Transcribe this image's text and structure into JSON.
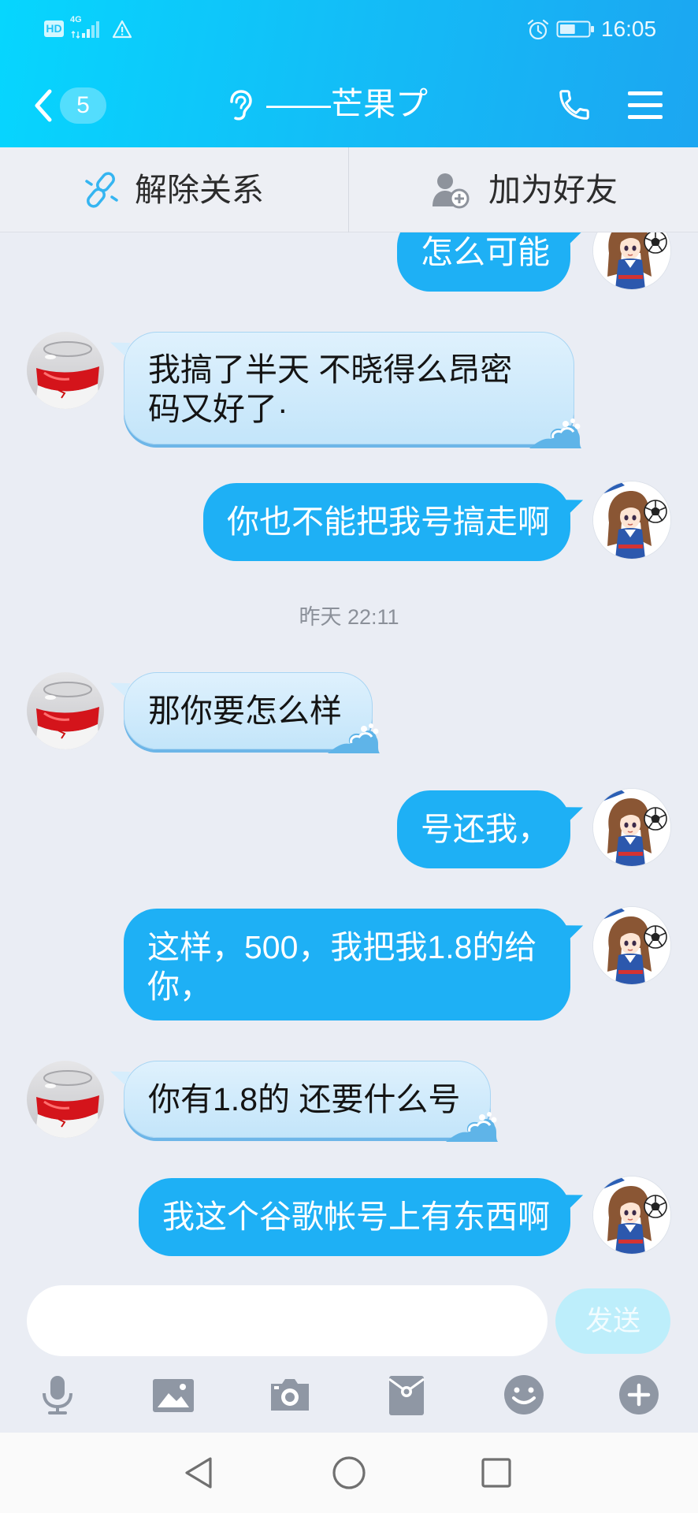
{
  "status_bar": {
    "hd_label": "HD",
    "network_label": "4G",
    "time": "16:05",
    "battery_level": 0.55,
    "icons": [
      "hd-icon",
      "signal-icon",
      "warning-icon",
      "alarm-icon",
      "battery-icon"
    ]
  },
  "header": {
    "unread_count": "5",
    "title": "——芒果プ",
    "icons": [
      "back-chevron-icon",
      "ear-icon",
      "phone-icon",
      "menu-icon"
    ]
  },
  "action_bar": {
    "unbind": {
      "label": "解除关系",
      "icon": "broken-link-icon"
    },
    "add_friend": {
      "label": "加为好友",
      "icon": "add-friend-icon"
    }
  },
  "chat": [
    {
      "outgoing": true,
      "text": "怎么可能"
    },
    {
      "outgoing": false,
      "text": "我搞了半天 不晓得么昂密码又好了·"
    },
    {
      "outgoing": true,
      "text": "你也不能把我号搞走啊"
    },
    {
      "timestamp": "昨天 22:11"
    },
    {
      "outgoing": false,
      "text": "那你要怎么样"
    },
    {
      "outgoing": true,
      "text": "号还我，"
    },
    {
      "outgoing": true,
      "text": "这样，500，我把我1.8的给你，"
    },
    {
      "outgoing": false,
      "text": "你有1.8的 还要什么号"
    },
    {
      "outgoing": true,
      "text": "我这个谷歌帐号上有东西啊"
    }
  ],
  "composer": {
    "input_value": "",
    "send_label": "发送"
  },
  "toolbar": [
    "microphone-icon",
    "image-icon",
    "camera-icon",
    "red-packet-icon",
    "emoji-icon",
    "plus-icon"
  ],
  "nav_bar": [
    "back-triangle-icon",
    "home-circle-icon",
    "recents-square-icon"
  ],
  "colors": {
    "header_gradient_start": "#06d6fe",
    "header_gradient_end": "#1ca6f1",
    "outgoing_bubble": "#1eb0f5",
    "incoming_bubble": "#c3e5fa",
    "chat_background": "#eaedf4",
    "send_button": "#bdeefb",
    "unbind_icon": "#35b5f1"
  }
}
